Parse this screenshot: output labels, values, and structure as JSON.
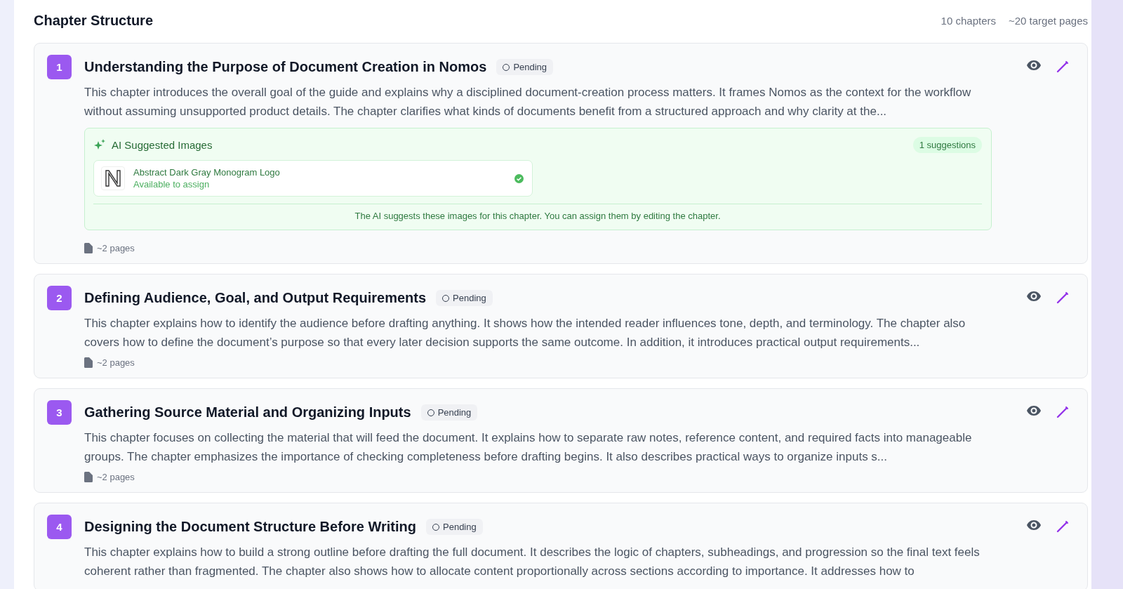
{
  "header": {
    "title": "Chapter Structure",
    "chapter_count": "10 chapters",
    "target_pages": "~20 target pages"
  },
  "chapters": [
    {
      "number": "1",
      "title": "Understanding the Purpose of Document Creation in Nomos",
      "status": "Pending",
      "description": "This chapter introduces the overall goal of the guide and explains why a disciplined document-creation process matters. It frames Nomos as the context for the workflow without assuming unsupported product details. The chapter clarifies what kinds of documents benefit from a structured approach and why clarity at the...",
      "suggestions": {
        "title": "AI Suggested Images",
        "count": "1 suggestions",
        "images": [
          {
            "name": "Abstract Dark Gray Monogram Logo",
            "status": "Available to assign",
            "available": true
          }
        ],
        "note": "The AI suggests these images for this chapter. You can assign them by editing the chapter."
      },
      "pages": "~2 pages"
    },
    {
      "number": "2",
      "title": "Defining Audience, Goal, and Output Requirements",
      "status": "Pending",
      "description": "This chapter explains how to identify the audience before drafting anything. It shows how the intended reader influences tone, depth, and terminology. The chapter also covers how to define the document’s purpose so that every later decision supports the same outcome. In addition, it introduces practical output requirements...",
      "pages": "~2 pages"
    },
    {
      "number": "3",
      "title": "Gathering Source Material and Organizing Inputs",
      "status": "Pending",
      "description": "This chapter focuses on collecting the material that will feed the document. It explains how to separate raw notes, reference content, and required facts into manageable groups. The chapter emphasizes the importance of checking completeness before drafting begins. It also describes practical ways to organize inputs s...",
      "pages": "~2 pages"
    },
    {
      "number": "4",
      "title": "Designing the Document Structure Before Writing",
      "status": "Pending",
      "description": "This chapter explains how to build a strong outline before drafting the full document. It describes the logic of chapters, subheadings, and progression so the final text feels coherent rather than fragmented. The chapter also shows how to allocate content proportionally across sections according to importance. It addresses how to"
    }
  ]
}
